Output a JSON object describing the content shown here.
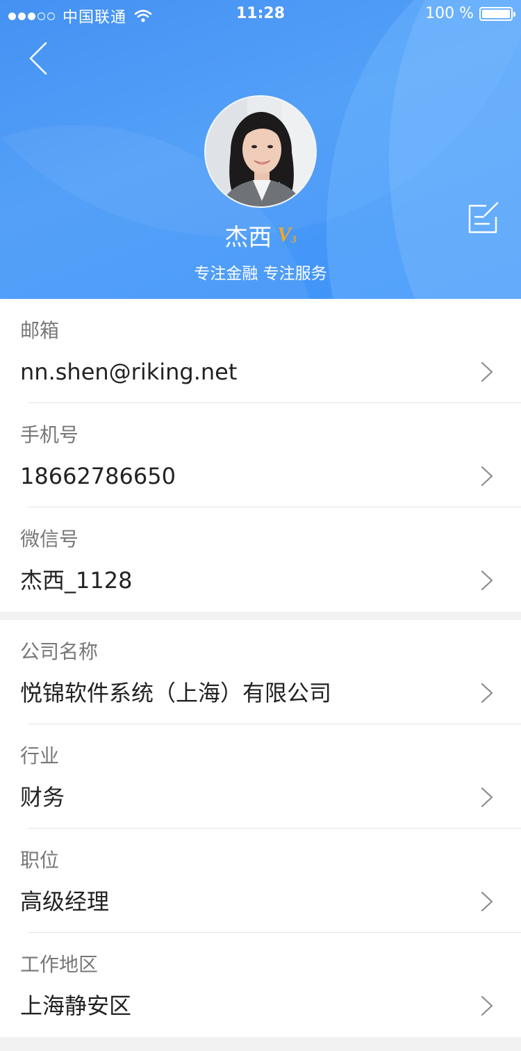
{
  "status_bar": {
    "carrier": "中国联通",
    "time": "11:28",
    "battery": "100 %",
    "signal_bars_filled": 3,
    "signal_bars_total": 5
  },
  "header": {
    "name": "杰西",
    "vip_letter": "V",
    "vip_level": "3",
    "slogan": "专注金融 专注服务",
    "accent_color": "#3f93f7",
    "badge_color": "#f5a623"
  },
  "icons": {
    "back": "back-arrow-icon",
    "edit": "edit-icon",
    "chevron": "chevron-right-icon"
  },
  "contact_section": [
    {
      "label": "邮箱",
      "value": "nn.shen@riking.net"
    },
    {
      "label": "手机号",
      "value": "18662786650"
    },
    {
      "label": "微信号",
      "value": "杰西_1128"
    }
  ],
  "work_section": [
    {
      "label": "公司名称",
      "value": "悦锦软件系统（上海）有限公司"
    },
    {
      "label": "行业",
      "value": "财务"
    },
    {
      "label": "职位",
      "value": "高级经理"
    },
    {
      "label": "工作地区",
      "value": "上海静安区"
    }
  ]
}
